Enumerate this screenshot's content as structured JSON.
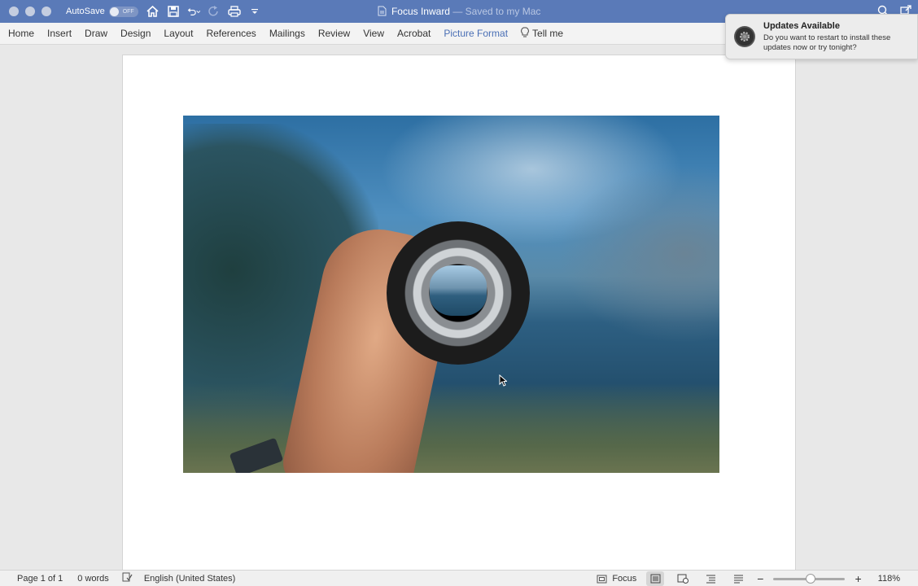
{
  "titlebar": {
    "autosave_label": "AutoSave",
    "autosave_state": "OFF",
    "doc_title": "Focus Inward",
    "saved_status": "— Saved to my Mac"
  },
  "ribbon": {
    "tabs": [
      "Home",
      "Insert",
      "Draw",
      "Design",
      "Layout",
      "References",
      "Mailings",
      "Review",
      "View",
      "Acrobat",
      "Picture Format"
    ],
    "active_tab": "Picture Format",
    "tell_me": "Tell me"
  },
  "notification": {
    "title": "Updates Available",
    "body": "Do you want to restart to install these updates now or try tonight?"
  },
  "statusbar": {
    "page": "Page 1 of 1",
    "words": "0 words",
    "language": "English (United States)",
    "focus": "Focus",
    "zoom": "118%"
  },
  "colors": {
    "titlebar": "#5a7ab8",
    "active_tab": "#4a6fb5"
  }
}
